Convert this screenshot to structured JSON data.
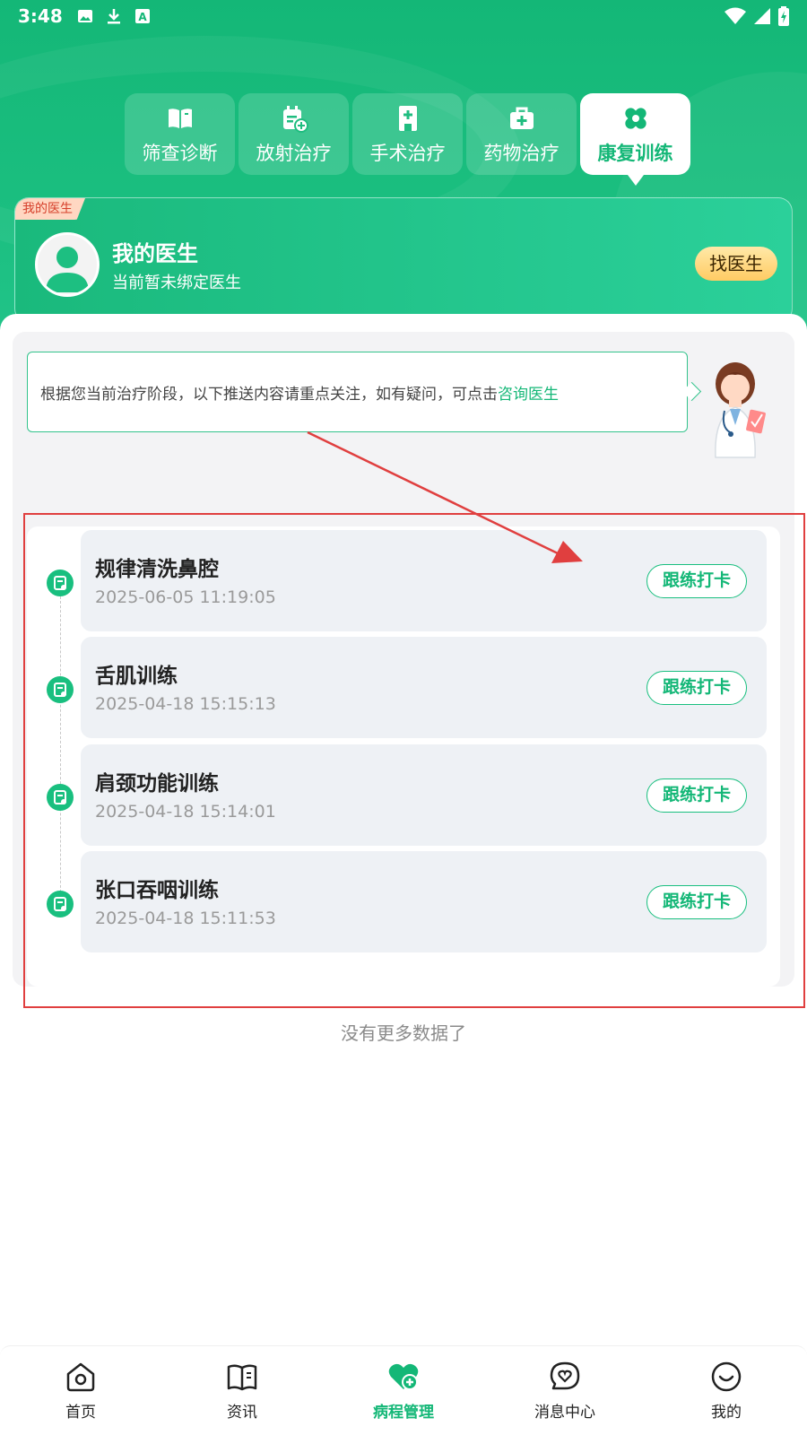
{
  "status_bar": {
    "time": "3:48",
    "icons": [
      "image-icon",
      "download-icon",
      "a-icon",
      "wifi-icon",
      "signal-icon",
      "battery-icon"
    ]
  },
  "tabs": [
    {
      "label": "筛查诊断",
      "icon": "book-icon",
      "active": false
    },
    {
      "label": "放射治疗",
      "icon": "calendar-plus-icon",
      "active": false
    },
    {
      "label": "手术治疗",
      "icon": "hospital-icon",
      "active": false
    },
    {
      "label": "药物治疗",
      "icon": "medkit-icon",
      "active": false
    },
    {
      "label": "康复训练",
      "icon": "bandage-icon",
      "active": true
    }
  ],
  "doctor_card": {
    "badge": "我的医生",
    "title": "我的医生",
    "subtitle": "当前暂未绑定医生",
    "find_button": "找医生"
  },
  "tip": {
    "text": "根据您当前治疗阶段，以下推送内容请重点关注，如有疑问，可点击",
    "link": "咨询医生"
  },
  "items": [
    {
      "title": "规律清洗鼻腔",
      "time": "2025-06-05 11:19:05",
      "button": "跟练打卡"
    },
    {
      "title": "舌肌训练",
      "time": "2025-04-18 15:15:13",
      "button": "跟练打卡"
    },
    {
      "title": "肩颈功能训练",
      "time": "2025-04-18 15:14:01",
      "button": "跟练打卡"
    },
    {
      "title": "张口吞咽训练",
      "time": "2025-04-18 15:11:53",
      "button": "跟练打卡"
    }
  ],
  "no_more": "没有更多数据了",
  "bottom_nav": [
    {
      "label": "首页",
      "icon": "home-icon",
      "active": false
    },
    {
      "label": "资讯",
      "icon": "news-book-icon",
      "active": false
    },
    {
      "label": "病程管理",
      "icon": "heart-plus-icon",
      "active": true
    },
    {
      "label": "消息中心",
      "icon": "message-heart-icon",
      "active": false
    },
    {
      "label": "我的",
      "icon": "smile-icon",
      "active": false
    }
  ],
  "colors": {
    "primary": "#14b777",
    "annotation_red": "#e03f3f",
    "find_button": "#ffcb63"
  }
}
